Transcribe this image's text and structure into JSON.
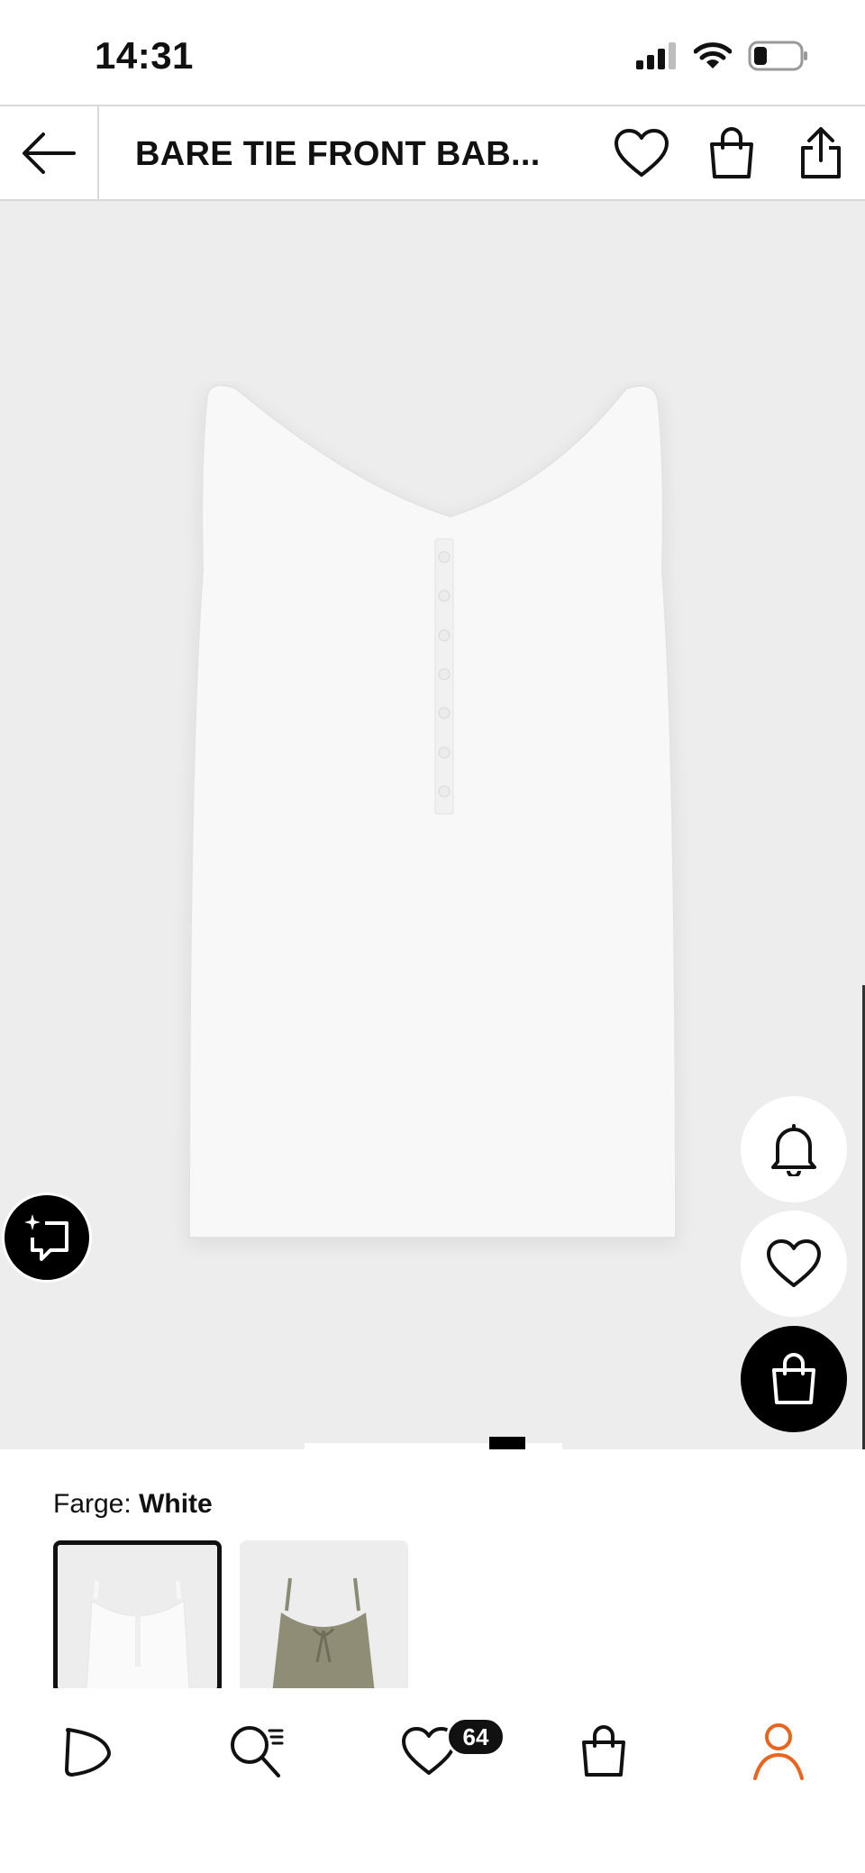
{
  "status_bar": {
    "time": "14:31",
    "icons": [
      "cellular-signal-icon",
      "wifi-icon",
      "battery-icon"
    ]
  },
  "header": {
    "title": "BARE TIE FRONT BAB...",
    "icons": [
      "back-arrow-icon",
      "heart-icon",
      "shopping-bag-icon",
      "share-icon"
    ]
  },
  "product_image": {
    "floating_buttons": [
      "bell-icon",
      "heart-icon",
      "shopping-bag-icon"
    ],
    "ai_button_icon": "sparkle-chat-icon",
    "pager": {
      "count": 2,
      "active_index": 1
    }
  },
  "color": {
    "label": "Farge:",
    "value": "White",
    "swatches": [
      {
        "name": "White",
        "selected": true
      },
      {
        "name": "Khaki",
        "selected": false
      }
    ]
  },
  "bottom_nav": {
    "items": [
      "play-icon",
      "search-list-icon",
      "wishlist-heart-icon",
      "bag-icon",
      "profile-icon"
    ],
    "wishlist_count": "64",
    "active": "profile-icon",
    "accent_color": "#e8641f"
  }
}
